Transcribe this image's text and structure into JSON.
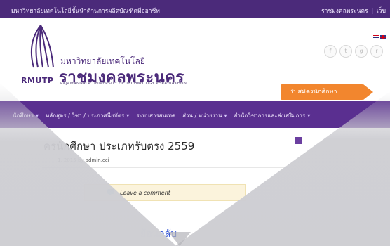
{
  "topbar": {
    "left_text": "มหาวิทยาลัยเทคโนโลยีชั้นนำด้านการผลิตบัณฑิตมืออาชีพ",
    "right_links": [
      "ราชมงคลพระนคร",
      "เว็บ"
    ]
  },
  "header": {
    "logo_abbr": "RMUTP",
    "uni_small": "มหาวิทยาลัยเทคโนโลยี",
    "uni_big": "ราชมงคลพระนคร",
    "uni_en": "RAJAMANGALA UNIVERSITY OF TECHNOLOGY PHRA NAKHON",
    "social_icons": [
      "facebook-icon",
      "twitter-icon",
      "google-plus-icon",
      "rss-icon"
    ],
    "apply_button": "รับสมัครนักศึกษา"
  },
  "nav": {
    "items": [
      {
        "label": "นักศึกษา",
        "dropdown": true
      },
      {
        "label": "หลักสูตร / วิชา / ประกาศนียบัตร",
        "dropdown": true
      },
      {
        "label": "ระบบสารสนเทศ",
        "dropdown": false
      },
      {
        "label": "ส่วน / หน่วยงาน",
        "dropdown": true
      },
      {
        "label": "สำนักวิชาการและส่งเสริมการ",
        "dropdown": true
      }
    ]
  },
  "post": {
    "title": "ครนักศึกษา ประเภทรับตรง 2559",
    "meta": "1, 2015 by admin.cci",
    "comment_text": "Leave a comment",
    "back_link": "ย้อนกลับ"
  },
  "colors": {
    "brand_purple": "#4b2a7a",
    "nav_purple": "#5a2f90",
    "accent_orange": "#f2862e"
  }
}
